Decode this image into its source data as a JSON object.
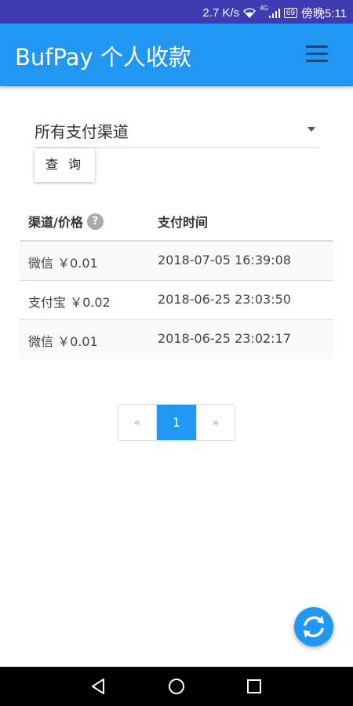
{
  "status_bar": {
    "speed": "2.7 K/s",
    "network": "4G",
    "battery": "69",
    "time": "傍晚5:11"
  },
  "app_bar": {
    "title": "BufPay 个人收款"
  },
  "filter": {
    "channel_selected": "所有支付渠道",
    "query_button": "查 询"
  },
  "table": {
    "headers": [
      "渠道/价格",
      "支付时间"
    ],
    "help_icon": "?",
    "rows": [
      {
        "channel_price": "微信 ￥0.01",
        "time": "2018-07-05 16:39:08"
      },
      {
        "channel_price": "支付宝 ￥0.02",
        "time": "2018-06-25 23:03:50"
      },
      {
        "channel_price": "微信 ￥0.01",
        "time": "2018-06-25 23:02:17"
      }
    ]
  },
  "pagination": {
    "prev": "«",
    "current": "1",
    "next": "»"
  },
  "colors": {
    "primary": "#2196f3",
    "status_bar": "#3f3bb3"
  },
  "icons": {
    "menu": "hamburger-menu-icon",
    "refresh": "refresh-icon",
    "nav_back": "back-triangle-icon",
    "nav_home": "home-circle-icon",
    "nav_recent": "recent-square-icon"
  }
}
